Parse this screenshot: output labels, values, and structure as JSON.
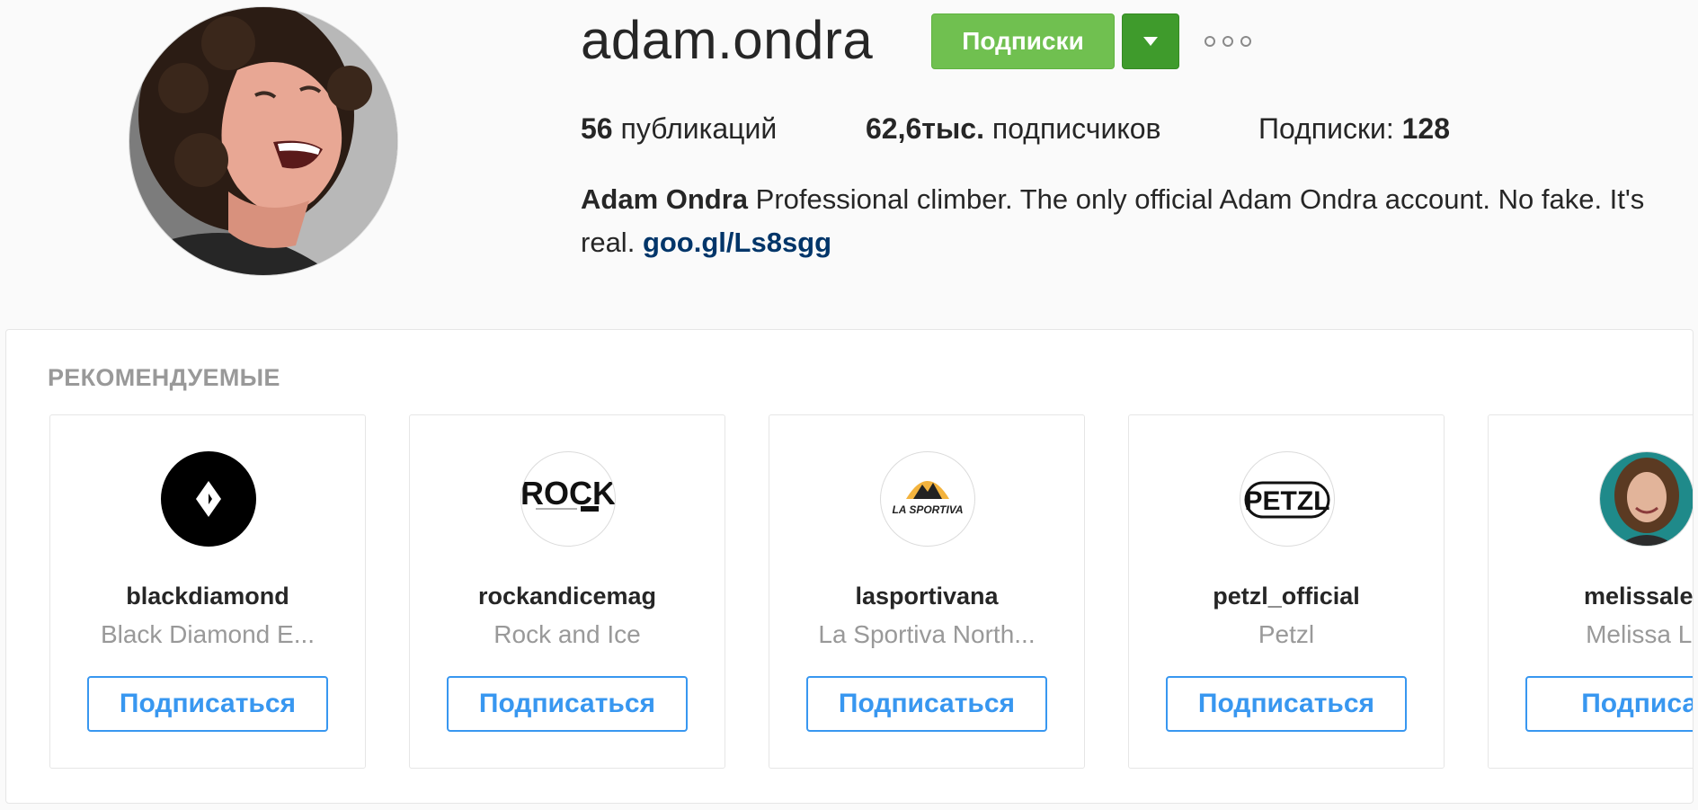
{
  "profile": {
    "username": "adam.ondra",
    "following_button": "Подписки",
    "posts_count": "56",
    "posts_label": "публикаций",
    "followers_count": "62,6тыс.",
    "followers_label": "подписчиков",
    "following_label": "Подписки:",
    "following_count": "128",
    "full_name": "Adam Ondra",
    "bio_text": "Professional climber. The only official Adam Ondra account. No fake. It's real.",
    "bio_link": "goo.gl/Ls8sgg"
  },
  "suggested": {
    "title": "РЕКОМЕНДУЕМЫЕ",
    "accounts": [
      {
        "handle": "blackdiamond",
        "name": "Black Diamond E...",
        "button": "Подписаться",
        "icon": "black-diamond-logo"
      },
      {
        "handle": "rockandicemag",
        "name": "Rock and Ice",
        "button": "Подписаться",
        "icon": "rock-and-ice-logo",
        "logo_text": "ROCK"
      },
      {
        "handle": "lasportivana",
        "name": "La Sportiva North...",
        "button": "Подписаться",
        "icon": "la-sportiva-logo",
        "logo_text": "LA SPORTIVA"
      },
      {
        "handle": "petzl_official",
        "name": "Petzl",
        "button": "Подписаться",
        "icon": "petzl-logo",
        "logo_text": "PETZL"
      },
      {
        "handle": "melissalen",
        "name": "Melissa Le",
        "button": "Подписат",
        "icon": "melissa-avatar"
      }
    ]
  },
  "colors": {
    "following_green": "#70c050",
    "dropdown_green": "#3f9b2c",
    "follow_blue": "#3897f0",
    "link_navy": "#003569"
  }
}
